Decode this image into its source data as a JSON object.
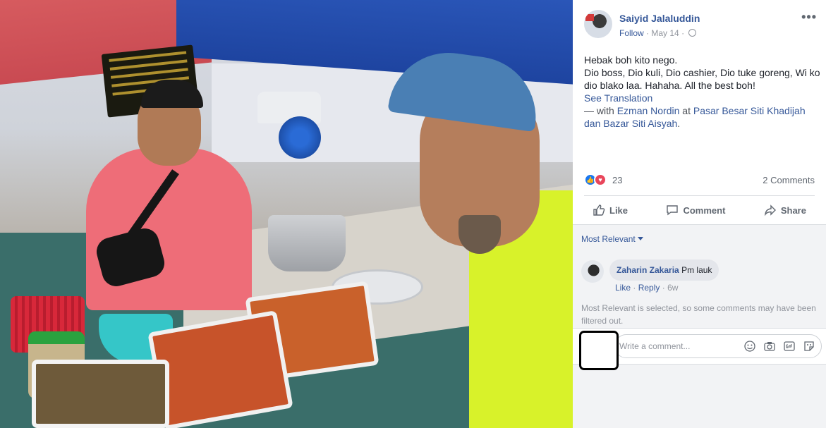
{
  "post": {
    "author": "Saiyid Jalaluddin",
    "follow_label": "Follow",
    "separator": "·",
    "date": "May 14",
    "separator2": "·",
    "more_label": "•••",
    "text_line1": "Hebak boh kito nego.",
    "text_line2": "Dio boss, Dio kuli, Dio cashier, Dio tuke goreng, Wi ko dio blako laa. Hahaha. All the best boh!",
    "see_translation": "See Translation",
    "with_prefix": "— with",
    "tagged_person": "Ezman Nordin",
    "at_word": "at",
    "location": "Pasar Besar Siti Khadijah dan Bazar Siti Aisyah",
    "period": "."
  },
  "reactions": {
    "count": "23",
    "comments_count": "2 Comments",
    "types": [
      "like-icon",
      "love-icon"
    ]
  },
  "actions": {
    "like": "Like",
    "comment": "Comment",
    "share": "Share"
  },
  "comments": {
    "sort_label": "Most Relevant",
    "items": [
      {
        "author": "Zaharin Zakaria",
        "text": "Pm lauk",
        "like": "Like",
        "dot": "·",
        "reply": "Reply",
        "dot2": "·",
        "time": "6w"
      }
    ],
    "filter_note": "Most Relevant is selected, so some comments may have been filtered out.",
    "write_placeholder": "Write a comment...",
    "input_icons": [
      "emoji-icon",
      "camera-icon",
      "gif-icon",
      "sticker-icon"
    ]
  },
  "colors": {
    "link": "#365899",
    "muted": "#90949c",
    "like_blue": "#1877f2",
    "love_red": "#e9465b"
  }
}
